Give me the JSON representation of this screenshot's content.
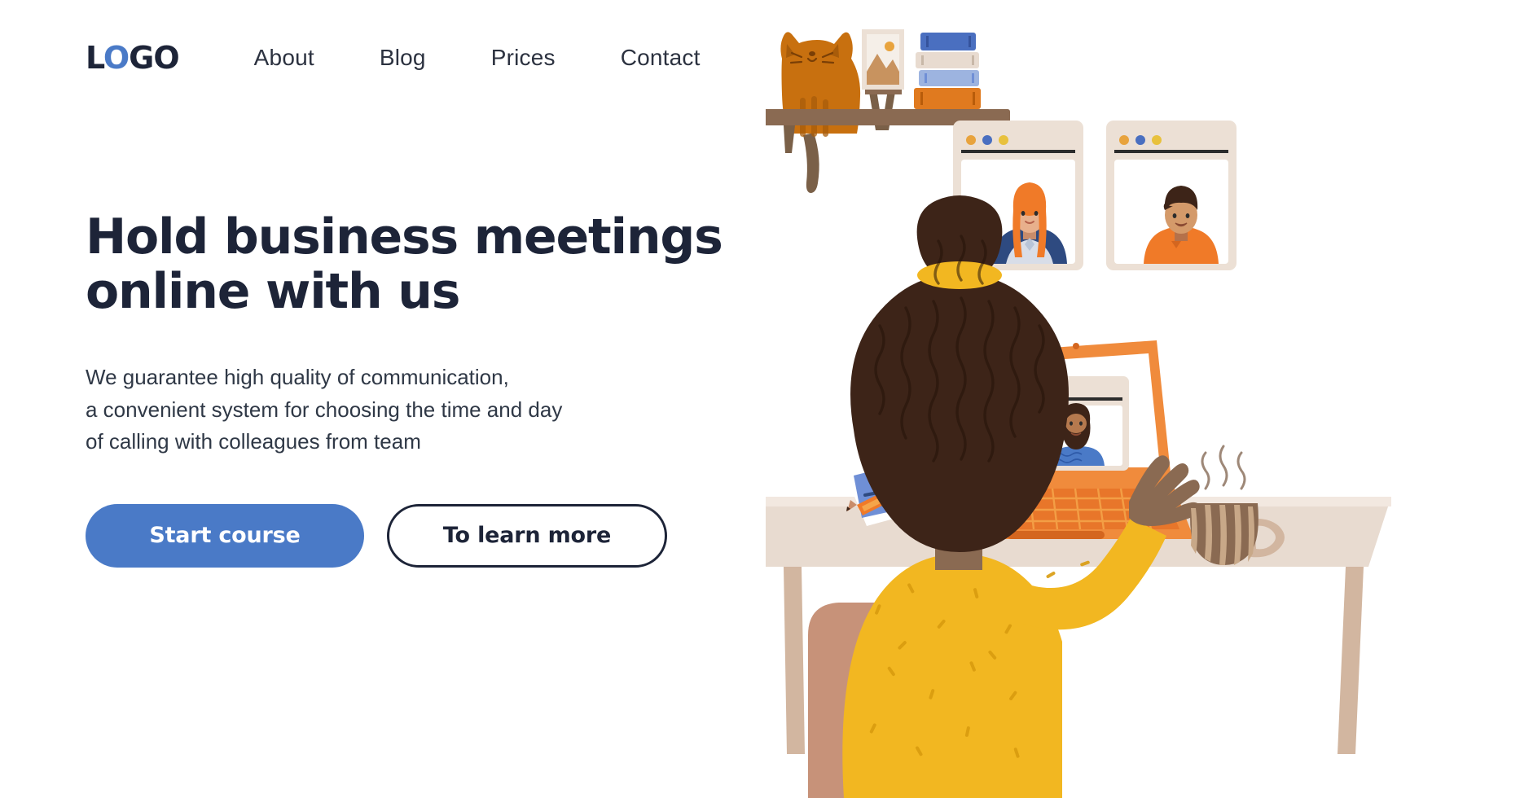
{
  "brand": {
    "logo_text": "LOGO",
    "logo_l": "L",
    "logo_o1": "O",
    "logo_go": "GO",
    "color_navy": "#1d2438",
    "color_blue": "#4a7ac7"
  },
  "nav": {
    "items": [
      {
        "label": "About"
      },
      {
        "label": "Blog"
      },
      {
        "label": "Prices"
      },
      {
        "label": "Contact"
      }
    ]
  },
  "hero": {
    "headline": "Hold business meetings\nonline with us",
    "subcopy": "We guarantee high quality of communication,\na convenient system for choosing the time and day\nof calling with colleagues from team",
    "primary_button": "Start course",
    "secondary_button": "To learn more"
  },
  "illustration": {
    "alt": "Woman on a video call at a desk with laptop, video call windows, cat on shelf",
    "colors": {
      "desk": "#ded0c3",
      "desk_top": "#e8dbd0",
      "sweater": "#f2b721",
      "hair": "#3d2418",
      "laptop": "#f08b3c",
      "window_frame": "#ece0d5",
      "cat": "#c8700f",
      "shelf": "#8a6a52",
      "chair": "#c79279",
      "notebook": "#6f8fd6",
      "dot_orange": "#e8a33d",
      "dot_blue": "#4a6fc0",
      "dot_yellow": "#e8c13d"
    },
    "video_windows": [
      {
        "name": "participant-window-1",
        "person": "woman-red-hair"
      },
      {
        "name": "participant-window-2",
        "person": "man-dark-hair"
      }
    ],
    "laptop_screen": {
      "name": "laptop-video-window",
      "person": "man-with-beard"
    },
    "desk_items": [
      "notebook",
      "pencil",
      "coffee-mug"
    ],
    "shelf_items": [
      "cat",
      "picture-frame",
      "books"
    ]
  }
}
